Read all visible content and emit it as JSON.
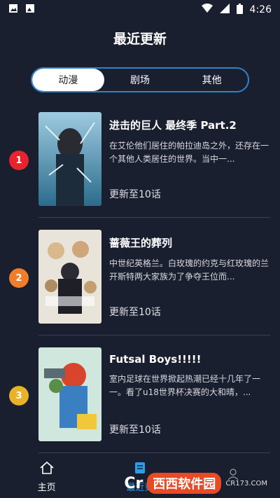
{
  "status_bar": {
    "time": "4:26",
    "icons": [
      "image-icon",
      "gallery-icon",
      "wifi-icon",
      "signal-icon",
      "battery-icon"
    ]
  },
  "header": {
    "title": "最近更新"
  },
  "tabs": [
    {
      "label": "动漫",
      "active": true
    },
    {
      "label": "剧场",
      "active": false
    },
    {
      "label": "其他",
      "active": false
    }
  ],
  "items": [
    {
      "rank": "1",
      "rank_color": "#e8232e",
      "title": "进击的巨人 最终季 Part.2",
      "desc": "在艾伦他们居住的帕拉迪岛之外，还存在一个其他人类居住的世界。当中一...",
      "progress": "更新至10话"
    },
    {
      "rank": "2",
      "rank_color": "#ef7d2a",
      "title": "蔷薇王的葬列",
      "desc": "中世纪英格兰。白玫瑰的约克与红玫瑰的兰开斯特两大家族为了争夺王位而...",
      "progress": "更新至10话"
    },
    {
      "rank": "3",
      "rank_color": "#e9b22a",
      "title": "Futsal Boys!!!!!",
      "desc": "室内足球在世界掀起热潮已经十几年了一一。看了u18世界杯决赛的大和晴，...",
      "progress": "更新至10话"
    }
  ],
  "bottom_nav": [
    {
      "label": "主页",
      "icon": "home-icon",
      "active": false
    },
    {
      "label": "最近更",
      "icon": "update-list-icon",
      "active": true
    },
    {
      "label": "",
      "icon": "profile-icon",
      "active": false
    }
  ],
  "watermark": {
    "text": "西西软件园",
    "sub": "CR173.COM",
    "logo": "Cr"
  }
}
